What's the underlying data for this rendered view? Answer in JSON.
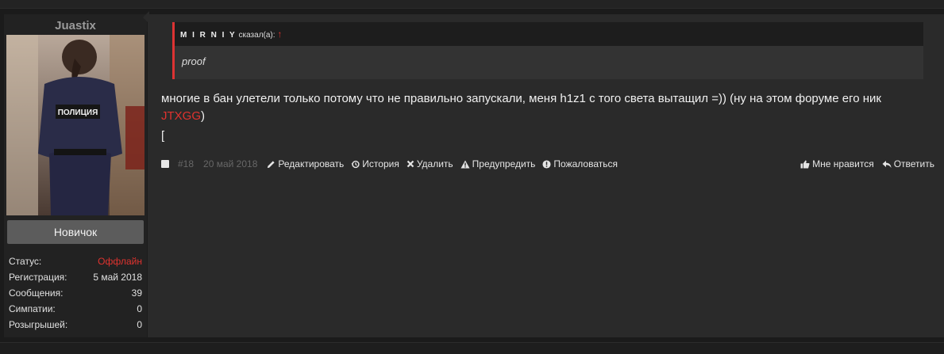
{
  "user": {
    "username": "Juastix",
    "avatar_badge": "ПОЛИЦИЯ",
    "rank": "Новичок",
    "info": [
      {
        "label": "Статус:",
        "value": "Оффлайн"
      },
      {
        "label": "Регистрация:",
        "value": "5 май 2018"
      },
      {
        "label": "Сообщения:",
        "value": "39"
      },
      {
        "label": "Симпатии:",
        "value": "0"
      },
      {
        "label": "Розыгрышей:",
        "value": "0"
      }
    ]
  },
  "post": {
    "quote": {
      "author": "M I R N I Y",
      "said": " сказал(а): ",
      "arrow": "↑",
      "body": "proof"
    },
    "text_before": "многие в бан улетели только потому что не правильно запускали, меня h1z1 с того света вытащил =)) (ну на этом форуме его ник ",
    "nick": "JTXGG",
    "text_after": ")",
    "bracket": "[",
    "number": "#18",
    "date": "20 май 2018",
    "actions": {
      "edit": "Редактировать",
      "history": "История",
      "delete": "Удалить",
      "warn": "Предупредить",
      "report": "Пожаловаться",
      "like": "Мне нравится",
      "reply": "Ответить"
    }
  },
  "colors": {
    "accent_red": "#e0332f",
    "background": "#1b1b1b",
    "panel": "#2a2a2a"
  }
}
